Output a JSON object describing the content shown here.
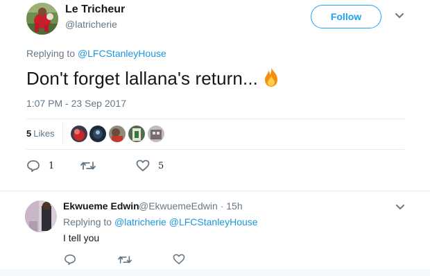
{
  "tweet": {
    "display_name": "Le Tricheur",
    "handle": "@latricherie",
    "follow_label": "Follow",
    "replying_prefix": "Replying to",
    "replying_to": "@LFCStanleyHouse",
    "text": "Don't forget lallana's return...",
    "emoji_icon": "fire-icon",
    "timestamp": "1:07 PM - 23 Sep 2017",
    "likes_count": "5",
    "likes_label": "Likes",
    "actions": {
      "reply_count": "1",
      "retweet_count": "",
      "like_count": "5"
    },
    "colors": {
      "accent": "#1da1f2",
      "link": "#1b95e0",
      "muted": "#657786"
    }
  },
  "reply": {
    "display_name": "Ekwueme Edwin",
    "meta": "@EkwuemeEdwin · 15h",
    "replying_prefix": "Replying to",
    "replying_to_1": "@latricherie",
    "replying_to_2": "@LFCStanleyHouse",
    "text": "I tell you"
  }
}
